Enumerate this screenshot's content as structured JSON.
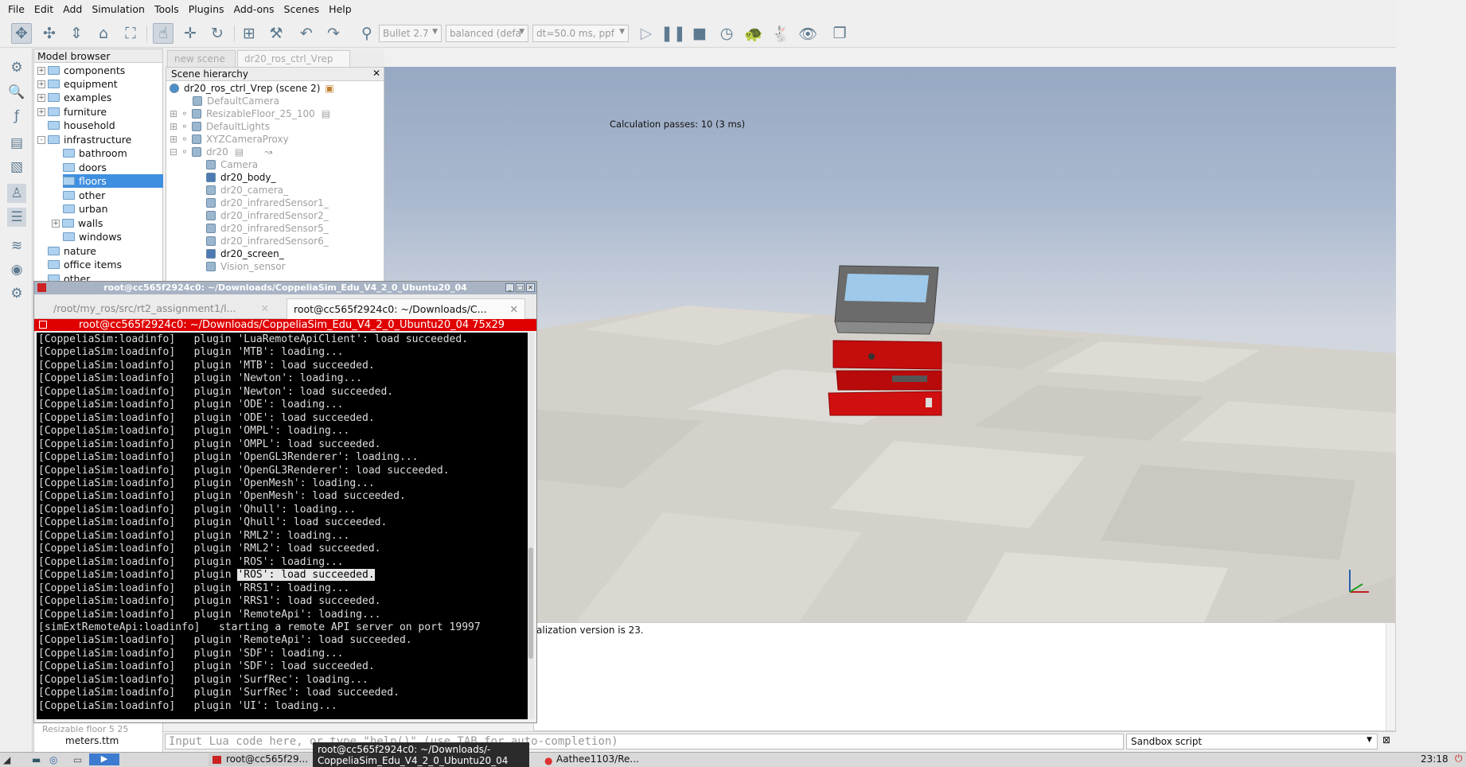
{
  "menu": [
    "File",
    "Edit",
    "Add",
    "Simulation",
    "Tools",
    "Plugins",
    "Add-ons",
    "Scenes",
    "Help"
  ],
  "toolbar": {
    "engine": "Bullet 2.7",
    "preset": "balanced (defa",
    "dt": "dt=50.0 ms, ppf"
  },
  "model_browser": {
    "title": "Model browser",
    "items": [
      {
        "label": "components",
        "expander": "+"
      },
      {
        "label": "equipment",
        "expander": "+"
      },
      {
        "label": "examples",
        "expander": "+"
      },
      {
        "label": "furniture",
        "expander": "+"
      },
      {
        "label": "household",
        "expander": ""
      },
      {
        "label": "infrastructure",
        "expander": "-"
      },
      {
        "label": "bathroom",
        "expander": ""
      },
      {
        "label": "doors",
        "expander": ""
      },
      {
        "label": "floors",
        "expander": "",
        "selected": true
      },
      {
        "label": "other",
        "expander": ""
      },
      {
        "label": "urban",
        "expander": ""
      },
      {
        "label": "walls",
        "expander": "+"
      },
      {
        "label": "windows",
        "expander": ""
      },
      {
        "label": "nature",
        "expander": ""
      },
      {
        "label": "office items",
        "expander": ""
      },
      {
        "label": "other",
        "expander": ""
      }
    ],
    "bottom_label_line1": "Resizable floor 5 25",
    "bottom_label_line2": "meters.ttm"
  },
  "scene_tabs": [
    "new scene",
    "dr20_ros_ctrl_Vrep"
  ],
  "scene_hierarchy": {
    "title": "Scene hierarchy",
    "root": "dr20_ros_ctrl_Vrep (scene 2)",
    "items": [
      {
        "label": "DefaultCamera"
      },
      {
        "label": "ResizableFloor_25_100"
      },
      {
        "label": "DefaultLights"
      },
      {
        "label": "XYZCameraProxy"
      },
      {
        "label": "dr20"
      },
      {
        "label": "Camera"
      },
      {
        "label": "dr20_body_"
      },
      {
        "label": "dr20_camera_"
      },
      {
        "label": "dr20_infraredSensor1_"
      },
      {
        "label": "dr20_infraredSensor2_"
      },
      {
        "label": "dr20_infraredSensor5_"
      },
      {
        "label": "dr20_infraredSensor6_"
      },
      {
        "label": "dr20_screen_"
      },
      {
        "label": "Vision_sensor"
      }
    ]
  },
  "viewport": {
    "calc_passes": "Calculation passes: 10 (3 ms)"
  },
  "status_console": {
    "line": "alization version is 23."
  },
  "lua": {
    "placeholder": "Input Lua code here, or type \"help()\" (use TAB for auto-completion)",
    "script": "Sandbox script"
  },
  "terminal": {
    "title": "root@cc565f2924c0: ~/Downloads/CoppeliaSim_Edu_V4_2_0_Ubuntu20_04",
    "tabs": [
      "/root/my_ros/src/rt2_assignment1/l...",
      "root@cc565f2924c0: ~/Downloads/C..."
    ],
    "header": "root@cc565f2924c0: ~/Downloads/CoppeliaSim_Edu_V4_2_0_Ubuntu20_04 75x29",
    "lines": [
      "[CoppeliaSim:loadinfo]   plugin 'LuaRemoteApiClient': load succeeded.",
      "[CoppeliaSim:loadinfo]   plugin 'MTB': loading...",
      "[CoppeliaSim:loadinfo]   plugin 'MTB': load succeeded.",
      "[CoppeliaSim:loadinfo]   plugin 'Newton': loading...",
      "[CoppeliaSim:loadinfo]   plugin 'Newton': load succeeded.",
      "[CoppeliaSim:loadinfo]   plugin 'ODE': loading...",
      "[CoppeliaSim:loadinfo]   plugin 'ODE': load succeeded.",
      "[CoppeliaSim:loadinfo]   plugin 'OMPL': loading...",
      "[CoppeliaSim:loadinfo]   plugin 'OMPL': load succeeded.",
      "[CoppeliaSim:loadinfo]   plugin 'OpenGL3Renderer': loading...",
      "[CoppeliaSim:loadinfo]   plugin 'OpenGL3Renderer': load succeeded.",
      "[CoppeliaSim:loadinfo]   plugin 'OpenMesh': loading...",
      "[CoppeliaSim:loadinfo]   plugin 'OpenMesh': load succeeded.",
      "[CoppeliaSim:loadinfo]   plugin 'Qhull': loading...",
      "[CoppeliaSim:loadinfo]   plugin 'Qhull': load succeeded.",
      "[CoppeliaSim:loadinfo]   plugin 'RML2': loading...",
      "[CoppeliaSim:loadinfo]   plugin 'RML2': load succeeded.",
      "[CoppeliaSim:loadinfo]   plugin 'ROS': loading...",
      "[CoppeliaSim:loadinfo]   plugin 'ROS': load succeeded.",
      "[CoppeliaSim:loadinfo]   plugin 'RRS1': loading...",
      "[CoppeliaSim:loadinfo]   plugin 'RRS1': load succeeded.",
      "[CoppeliaSim:loadinfo]   plugin 'RemoteApi': loading...",
      "[simExtRemoteApi:loadinfo]   starting a remote API server on port 19997",
      "[CoppeliaSim:loadinfo]   plugin 'RemoteApi': load succeeded.",
      "[CoppeliaSim:loadinfo]   plugin 'SDF': loading...",
      "[CoppeliaSim:loadinfo]   plugin 'SDF': load succeeded.",
      "[CoppeliaSim:loadinfo]   plugin 'SurfRec': loading...",
      "[CoppeliaSim:loadinfo]   plugin 'SurfRec': load succeeded.",
      "[CoppeliaSim:loadinfo]   plugin 'UI': loading..."
    ],
    "highlight": {
      "line": 18,
      "prefix": "[CoppeliaSim:loadinfo]   plugin ",
      "text": "'ROS': load succeeded."
    }
  },
  "taskbar": {
    "item1": "root@cc565f29...",
    "tooltip_line1": "root@cc565f2924c0: ~/Downloads/-",
    "tooltip_line2": "CoppeliaSim_Edu_V4_2_0_Ubuntu20_04",
    "item2": "Aathee1103/Re...",
    "clock": "23:18"
  }
}
